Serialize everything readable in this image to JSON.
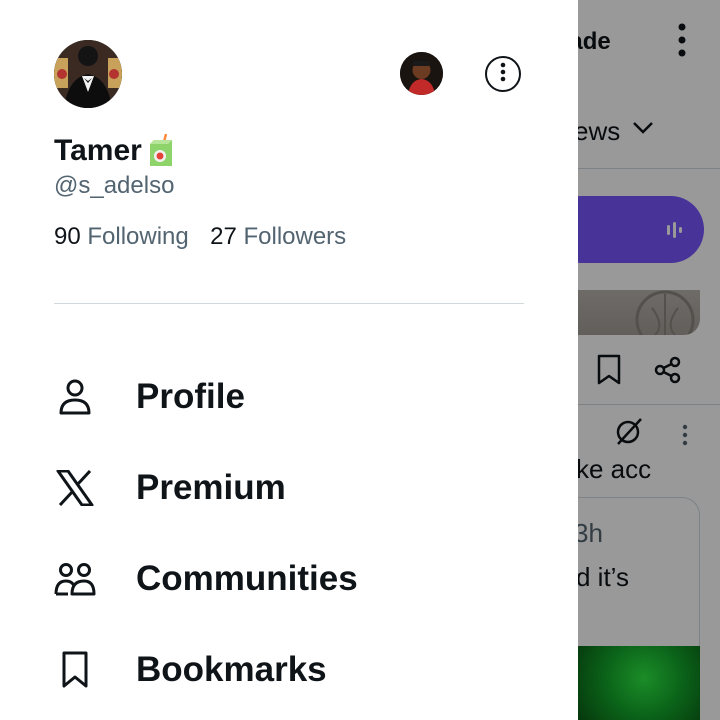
{
  "profile": {
    "name": "Tamer",
    "emoji": "🧃",
    "handle": "@s_adelso",
    "following_count": "90",
    "following_label": "Following",
    "followers_count": "27",
    "followers_label": "Followers"
  },
  "menu": [
    {
      "label": "Profile",
      "icon": "person-icon"
    },
    {
      "label": "Premium",
      "icon": "x-logo-icon"
    },
    {
      "label": "Communities",
      "icon": "communities-icon"
    },
    {
      "label": "Bookmarks",
      "icon": "bookmark-icon"
    }
  ],
  "background": {
    "upgrade_partial": "rade",
    "news_partial": "ews",
    "post_text_partial": "ke acc",
    "time_partial": "3h",
    "quote_text_partial": "d it’s"
  },
  "colors": {
    "text": "#0f1419",
    "secondary_text": "#536471",
    "divider": "#cfd9de",
    "spaces_pill": "#7856ff",
    "overlay": "rgba(0,0,0,0.40)"
  }
}
